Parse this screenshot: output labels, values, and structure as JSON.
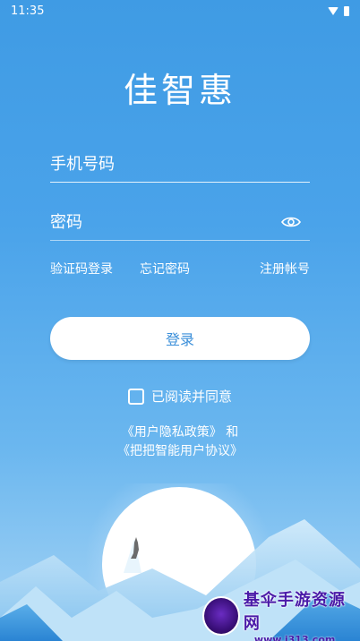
{
  "status_bar": {
    "time": "11:35"
  },
  "app_title": "佳智惠",
  "phone_field": {
    "placeholder": "手机号码"
  },
  "password_field": {
    "placeholder": "密码"
  },
  "links": {
    "sms_login": "验证码登录",
    "forgot_password": "忘记密码",
    "register": "注册帐号"
  },
  "login_button": {
    "label": "登录"
  },
  "agreement": {
    "label": "已阅读并同意",
    "privacy_policy": "《用户隐私政策》 和",
    "user_agreement": "《把把智能用户协议》"
  },
  "watermark": {
    "title": "基伞手游资源网",
    "url": "www.j313.com"
  },
  "colors": {
    "background_top": "#3f9be4",
    "background_bottom": "#a6d4f5",
    "button_bg": "#ffffff",
    "button_text": "#3b8fd9"
  }
}
